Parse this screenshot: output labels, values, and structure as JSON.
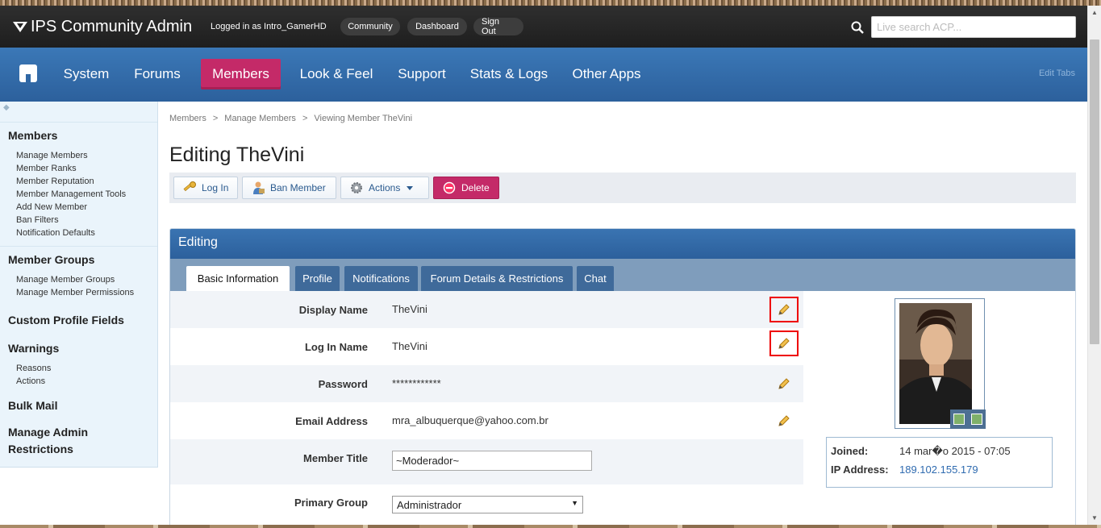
{
  "header": {
    "app_title": "IPS Community Admin",
    "logged_in_text": "Logged in as Intro_GamerHD",
    "links": [
      "Community",
      "Dashboard",
      "Sign Out"
    ],
    "search_placeholder": "Live search ACP..."
  },
  "nav": {
    "tabs": [
      "System",
      "Forums",
      "Members",
      "Look & Feel",
      "Support",
      "Stats & Logs",
      "Other Apps"
    ],
    "active_tab": "Members",
    "edit_tabs_label": "Edit Tabs"
  },
  "sidebar": {
    "collapse_glyph": "◆",
    "groups": [
      {
        "title": "Members",
        "items": [
          "Manage Members",
          "Member Ranks",
          "Member Reputation",
          "Member Management Tools",
          "Add New Member",
          "Ban Filters",
          "Notification Defaults"
        ]
      },
      {
        "title": "Member Groups",
        "items": [
          "Manage Member Groups",
          "Manage Member Permissions"
        ]
      },
      {
        "title": "Custom Profile Fields",
        "items": []
      },
      {
        "title": "Warnings",
        "items": [
          "Reasons",
          "Actions"
        ]
      },
      {
        "title": "Bulk Mail",
        "items": []
      },
      {
        "title": "Manage Admin Restrictions",
        "items": []
      }
    ]
  },
  "breadcrumb": {
    "items": [
      "Members",
      "Manage Members",
      "Viewing Member TheVini"
    ],
    "separator": ">"
  },
  "page": {
    "title": "Editing TheVini"
  },
  "toolbar": {
    "login_label": "Log In",
    "ban_label": "Ban Member",
    "actions_label": "Actions",
    "delete_label": "Delete"
  },
  "panel": {
    "title": "Editing",
    "tabs": [
      "Basic Information",
      "Profile",
      "Notifications",
      "Forum Details & Restrictions",
      "Chat"
    ],
    "active_tab": "Basic Information"
  },
  "form": {
    "display_name": {
      "label": "Display Name",
      "value": "TheVini"
    },
    "login_name": {
      "label": "Log In Name",
      "value": "TheVini"
    },
    "password": {
      "label": "Password",
      "value": "************"
    },
    "email": {
      "label": "Email Address",
      "value": "mra_albuquerque@yahoo.com.br"
    },
    "member_title": {
      "label": "Member Title",
      "value": "~Moderador~"
    },
    "primary_group": {
      "label": "Primary Group",
      "value": "Administrador"
    }
  },
  "member_info": {
    "joined_label": "Joined:",
    "joined_value": "14 mar�o 2015 - 07:05",
    "ip_label": "IP Address:",
    "ip_value": "189.102.155.179"
  },
  "colors": {
    "accent_pink": "#c42a68",
    "nav_blue": "#3b78b7",
    "header_dark": "#262626",
    "link_blue": "#2f6bb0"
  }
}
